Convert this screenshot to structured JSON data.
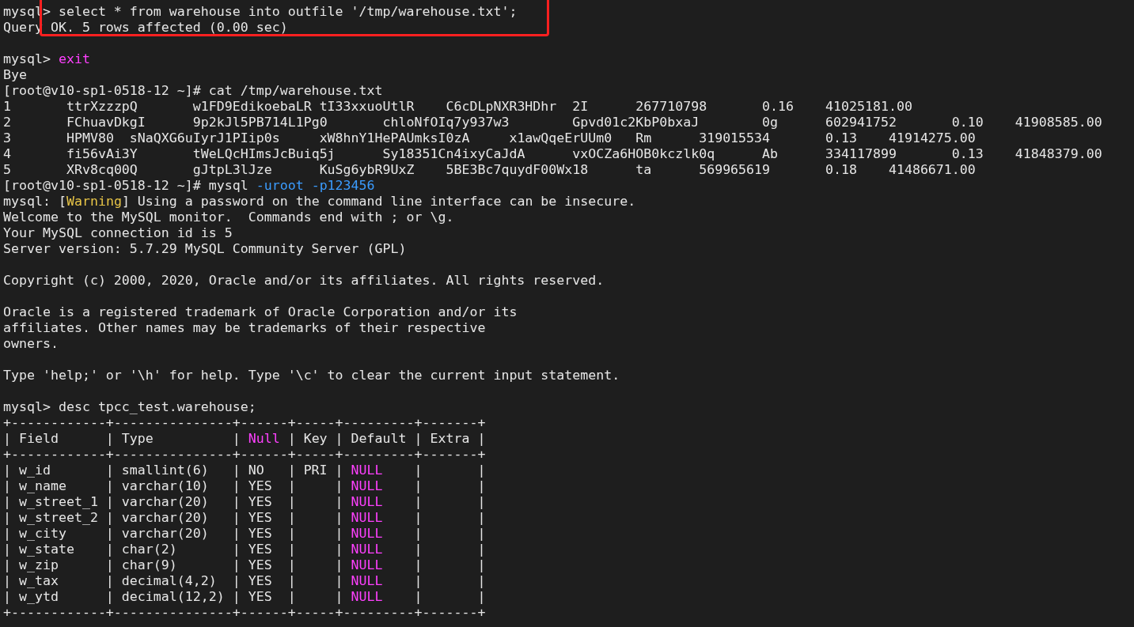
{
  "terminal": {
    "lines": [
      {
        "kind": "text",
        "segments": [
          {
            "text": "mysql> select * from warehouse into outfile '/tmp/warehouse.txt';"
          }
        ]
      },
      {
        "kind": "text",
        "segments": [
          {
            "text": "Query OK. 5 rows affected (0.00 sec)"
          }
        ]
      },
      {
        "kind": "blank"
      },
      {
        "kind": "text",
        "segments": [
          {
            "text": "mysql> "
          },
          {
            "text": "exit",
            "color": "#ff40ff"
          }
        ]
      },
      {
        "kind": "text",
        "segments": [
          {
            "text": "Bye"
          }
        ]
      },
      {
        "kind": "text",
        "segments": [
          {
            "text": "[root@v10-sp1-0518-12 ~]# cat /tmp/warehouse.txt"
          }
        ]
      },
      {
        "kind": "row",
        "cells": [
          "1",
          "ttrXzzzpQ",
          "w1FD9EdikoebaLR",
          "tI33xxuoUtlR",
          "C6cDLpNXR3HDhr",
          "2I",
          "267710798",
          "0.16",
          "41025181.00"
        ]
      },
      {
        "kind": "row",
        "cells": [
          "2",
          "FChuavDkgI",
          "9p2kJl5PB714L1Pg0",
          "chloNfOIq7y937w3",
          "Gpvd01c2KbP0bxaJ",
          "0g",
          "602941752",
          "0.10",
          "41908585.00"
        ]
      },
      {
        "kind": "row",
        "cells": [
          "3",
          "HPMV80",
          "sNaQXG6uIyrJ1PIip0s",
          "xW8hnY1HePAUmksI0zA",
          "x1awQqeErUUm0",
          "Rm",
          "319015534",
          "0.13",
          "41914275.00"
        ]
      },
      {
        "kind": "row",
        "cells": [
          "4",
          "fi56vAi3Y",
          "tWeLQcHImsJcBuiq5j",
          "Sy18351Cn4ixyCaJdA",
          "vxOCZa6HOB0kczlk0q",
          "Ab",
          "334117899",
          "0.13",
          "41848379.00"
        ]
      },
      {
        "kind": "row",
        "cells": [
          "5",
          "XRv8cq00Q",
          "gJtpL3lJze",
          "KuSg6ybR9UxZ",
          "5BE3Bc7quydF00Wx18",
          "ta",
          "569965619",
          "0.18",
          "41486671.00"
        ]
      },
      {
        "kind": "text",
        "segments": [
          {
            "text": "[root@v10-sp1-0518-12 ~]# mysql "
          },
          {
            "text": "-uroot -p123456",
            "color": "#3b9cff"
          }
        ]
      },
      {
        "kind": "text",
        "segments": [
          {
            "text": "mysql: ["
          },
          {
            "text": "Warning",
            "color": "#e8c547"
          },
          {
            "text": "] Using a password on the command line interface can be insecure."
          }
        ]
      },
      {
        "kind": "text",
        "segments": [
          {
            "text": "Welcome to the MySQL monitor.  Commands end with ; or \\g."
          }
        ]
      },
      {
        "kind": "text",
        "segments": [
          {
            "text": "Your MySQL connection id is 5"
          }
        ]
      },
      {
        "kind": "text",
        "segments": [
          {
            "text": "Server version: 5.7.29 MySQL Community Server (GPL)"
          }
        ]
      },
      {
        "kind": "blank"
      },
      {
        "kind": "text",
        "segments": [
          {
            "text": "Copyright (c) 2000, 2020, Oracle and/or its affiliates. All rights reserved."
          }
        ]
      },
      {
        "kind": "blank"
      },
      {
        "kind": "text",
        "segments": [
          {
            "text": "Oracle is a registered trademark of Oracle Corporation and/or its"
          }
        ]
      },
      {
        "kind": "text",
        "segments": [
          {
            "text": "affiliates. Other names may be trademarks of their respective"
          }
        ]
      },
      {
        "kind": "text",
        "segments": [
          {
            "text": "owners."
          }
        ]
      },
      {
        "kind": "blank"
      },
      {
        "kind": "text",
        "segments": [
          {
            "text": "Type 'help;' or '\\h' for help. Type '\\c' to clear the current input statement."
          }
        ]
      },
      {
        "kind": "blank"
      },
      {
        "kind": "text",
        "segments": [
          {
            "text": "mysql> desc tpcc_test.warehouse;"
          }
        ]
      },
      {
        "kind": "text",
        "segments": [
          {
            "text": "+------------+---------------+------+-----+---------+-------+"
          }
        ]
      },
      {
        "kind": "text",
        "segments": [
          {
            "text": "| Field      | Type          | "
          },
          {
            "text": "Null",
            "color": "#ff40ff"
          },
          {
            "text": " | Key | Default | Extra |"
          }
        ]
      },
      {
        "kind": "text",
        "segments": [
          {
            "text": "+------------+---------------+------+-----+---------+-------+"
          }
        ]
      },
      {
        "kind": "text",
        "segments": [
          {
            "text": "| w_id       | smallint(6)   | NO   | PRI | "
          },
          {
            "text": "NULL",
            "color": "#ff40ff"
          },
          {
            "text": "    |       |"
          }
        ]
      },
      {
        "kind": "text",
        "segments": [
          {
            "text": "| w_name     | varchar(10)   | YES  |     | "
          },
          {
            "text": "NULL",
            "color": "#ff40ff"
          },
          {
            "text": "    |       |"
          }
        ]
      },
      {
        "kind": "text",
        "segments": [
          {
            "text": "| w_street_1 | varchar(20)   | YES  |     | "
          },
          {
            "text": "NULL",
            "color": "#ff40ff"
          },
          {
            "text": "    |       |"
          }
        ]
      },
      {
        "kind": "text",
        "segments": [
          {
            "text": "| w_street_2 | varchar(20)   | YES  |     | "
          },
          {
            "text": "NULL",
            "color": "#ff40ff"
          },
          {
            "text": "    |       |"
          }
        ]
      },
      {
        "kind": "text",
        "segments": [
          {
            "text": "| w_city     | varchar(20)   | YES  |     | "
          },
          {
            "text": "NULL",
            "color": "#ff40ff"
          },
          {
            "text": "    |       |"
          }
        ]
      },
      {
        "kind": "text",
        "segments": [
          {
            "text": "| w_state    | char(2)       | YES  |     | "
          },
          {
            "text": "NULL",
            "color": "#ff40ff"
          },
          {
            "text": "    |       |"
          }
        ]
      },
      {
        "kind": "text",
        "segments": [
          {
            "text": "| w_zip      | char(9)       | YES  |     | "
          },
          {
            "text": "NULL",
            "color": "#ff40ff"
          },
          {
            "text": "    |       |"
          }
        ]
      },
      {
        "kind": "text",
        "segments": [
          {
            "text": "| w_tax      | decimal(4,2)  | YES  |     | "
          },
          {
            "text": "NULL",
            "color": "#ff40ff"
          },
          {
            "text": "    |       |"
          }
        ]
      },
      {
        "kind": "text",
        "segments": [
          {
            "text": "| w_ytd      | decimal(12,2) | YES  |     | "
          },
          {
            "text": "NULL",
            "color": "#ff40ff"
          },
          {
            "text": "    |       |"
          }
        ]
      },
      {
        "kind": "text",
        "segments": [
          {
            "text": "+------------+---------------+------+-----+---------+-------+"
          }
        ]
      }
    ]
  }
}
